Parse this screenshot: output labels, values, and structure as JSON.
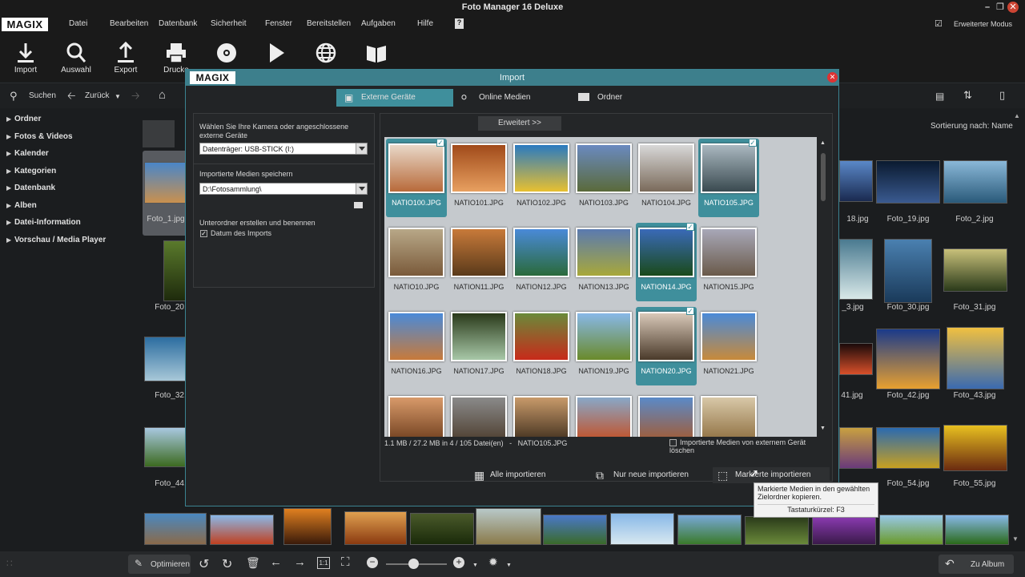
{
  "app": {
    "title": "Foto Manager 16 Deluxe",
    "logo": "MAGIX"
  },
  "menu": [
    "Datei",
    "Bearbeiten",
    "Datenbank",
    "Sicherheit",
    "Fenster",
    "Bereitstellen",
    "Aufgaben",
    "Hilfe"
  ],
  "mode_label": "Erweiterter Modus",
  "toolbar": [
    {
      "label": "Import",
      "icon": "download-icon"
    },
    {
      "label": "Auswahl",
      "icon": "search-icon"
    },
    {
      "label": "Export",
      "icon": "upload-icon"
    },
    {
      "label": "Drucke",
      "icon": "printer-icon"
    },
    {
      "label": "",
      "icon": "disc-icon"
    },
    {
      "label": "",
      "icon": "play-icon"
    },
    {
      "label": "",
      "icon": "globe-icon"
    },
    {
      "label": "",
      "icon": "book-icon"
    }
  ],
  "nav": {
    "search": "Suchen",
    "back": "Zurück"
  },
  "sort_label": "Sortierung nach: Name",
  "sidebar": [
    "Ordner",
    "Fotos & Videos",
    "Kalender",
    "Kategorien",
    "Datenbank",
    "Alben",
    "Datei-Information",
    "Vorschau / Media Player"
  ],
  "main_labels": [
    {
      "t": "Foto_1.jpg"
    },
    {
      "t": "Foto_20."
    },
    {
      "t": "Foto_32."
    },
    {
      "t": "Foto_44."
    },
    {
      "t": "18.jpg"
    },
    {
      "t": "Foto_19.jpg"
    },
    {
      "t": "Foto_2.jpg"
    },
    {
      "t": "_3.jpg"
    },
    {
      "t": "Foto_30.jpg"
    },
    {
      "t": "Foto_31.jpg"
    },
    {
      "t": "41.jpg"
    },
    {
      "t": "Foto_42.jpg"
    },
    {
      "t": "Foto_43.jpg"
    },
    {
      "t": "Foto_54.jpg"
    },
    {
      "t": "Foto_55.jpg"
    }
  ],
  "dialog": {
    "logo": "MAGIX",
    "title": "Import",
    "tabs": [
      "Externe Geräte",
      "Online Medien",
      "Ordner"
    ],
    "camera_label": "Wählen Sie Ihre Kamera oder angeschlossene externe Geräte",
    "camera_value": "Datenträger: USB-STICK (I:)",
    "save_label": "Importierte Medien speichern",
    "save_value": "D:\\Fotosammlung\\",
    "subfolder_label": "Unterordner erstellen und benennen",
    "subfolder_option": "Datum des Imports",
    "advanced_button": "Erweitert >>",
    "status": "1.1 MB / 27.2 MB in 4 / 105 Datei(en)   -   NATIO105.JPG",
    "delete_option": "Importierte Medien von externem Gerät löschen",
    "btn_all": "Alle importieren",
    "btn_new": "Nur neue importieren",
    "btn_marked": "Markierte importieren",
    "files": [
      {
        "name": "NATIO100.JPG",
        "sel": true
      },
      {
        "name": "NATIO101.JPG",
        "sel": false
      },
      {
        "name": "NATIO102.JPG",
        "sel": false
      },
      {
        "name": "NATIO103.JPG",
        "sel": false
      },
      {
        "name": "NATIO104.JPG",
        "sel": false
      },
      {
        "name": "NATIO105.JPG",
        "sel": true
      },
      {
        "name": "NATIO10.JPG",
        "sel": false
      },
      {
        "name": "NATION11.JPG",
        "sel": false
      },
      {
        "name": "NATION12.JPG",
        "sel": false
      },
      {
        "name": "NATION13.JPG",
        "sel": false
      },
      {
        "name": "NATION14.JPG",
        "sel": true
      },
      {
        "name": "NATION15.JPG",
        "sel": false
      },
      {
        "name": "NATION16.JPG",
        "sel": false
      },
      {
        "name": "NATION17.JPG",
        "sel": false
      },
      {
        "name": "NATION18.JPG",
        "sel": false
      },
      {
        "name": "NATION19.JPG",
        "sel": false
      },
      {
        "name": "NATION20.JPG",
        "sel": true
      },
      {
        "name": "NATION21.JPG",
        "sel": false
      },
      {
        "name": "",
        "sel": false
      },
      {
        "name": "",
        "sel": false
      },
      {
        "name": "",
        "sel": false
      },
      {
        "name": "",
        "sel": false
      },
      {
        "name": "",
        "sel": false
      },
      {
        "name": "",
        "sel": false
      }
    ]
  },
  "tooltip": {
    "text": "Markierte Medien in den gewählten Zielordner kopieren.",
    "shortcut": "Tastaturkürzel: F3"
  },
  "bottom": {
    "optimize": "Optimieren",
    "album": "Zu Album",
    "ratio": "1:1"
  }
}
